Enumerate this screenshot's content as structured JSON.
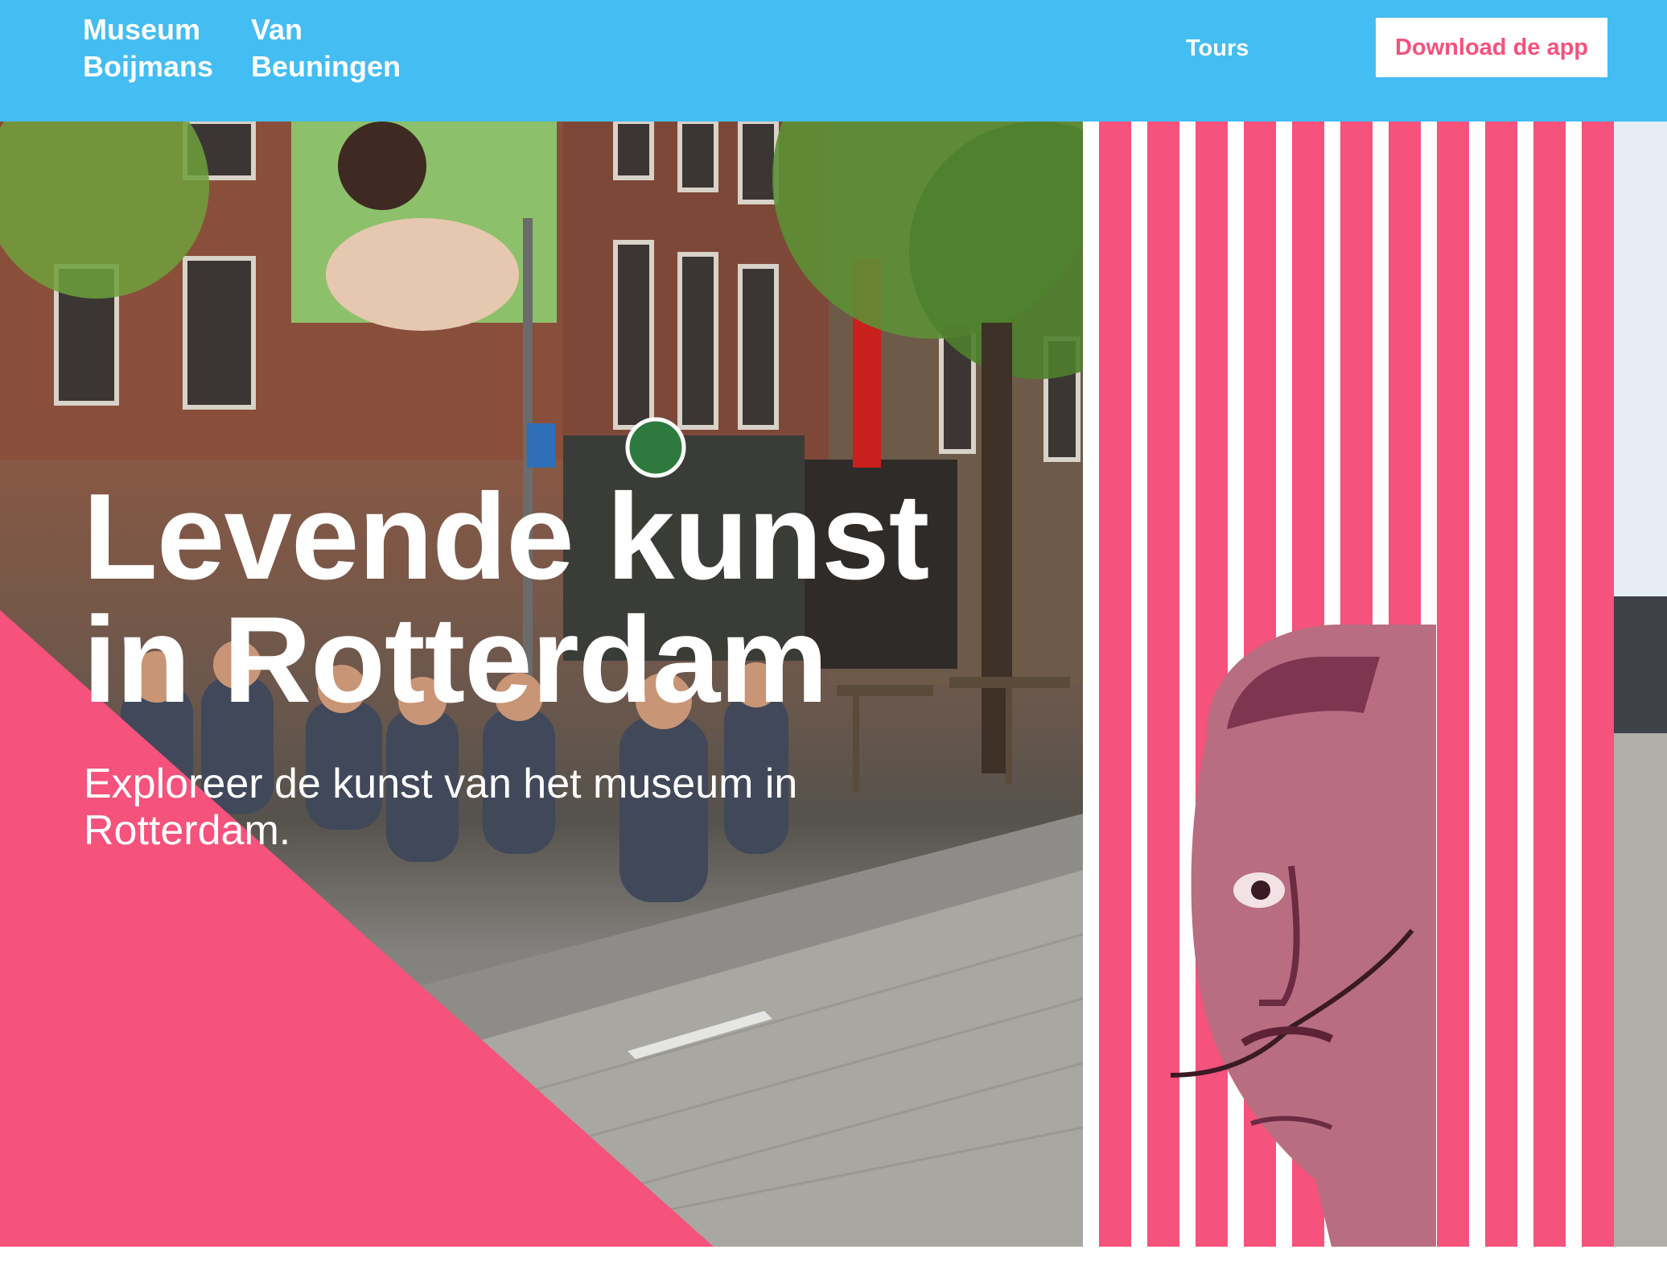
{
  "header": {
    "logo": {
      "line1": [
        "Museum",
        "Van"
      ],
      "line2": [
        "Boijmans",
        "Beuningen"
      ]
    },
    "nav": {
      "tours_label": "Tours",
      "download_label": "Download de app"
    }
  },
  "hero": {
    "title_lines": [
      "Levende kunst",
      "in Rotterdam"
    ],
    "subtitle": "Exploreer de kunst van het museum in Rotterdam.",
    "images": {
      "left": "street-terrace-photo",
      "right": "street-trees-photo",
      "overlay": "dali-portrait-collage"
    }
  },
  "colors": {
    "header_bg": "#44bdf3",
    "accent_pink": "#f5527c",
    "white": "#ffffff"
  }
}
